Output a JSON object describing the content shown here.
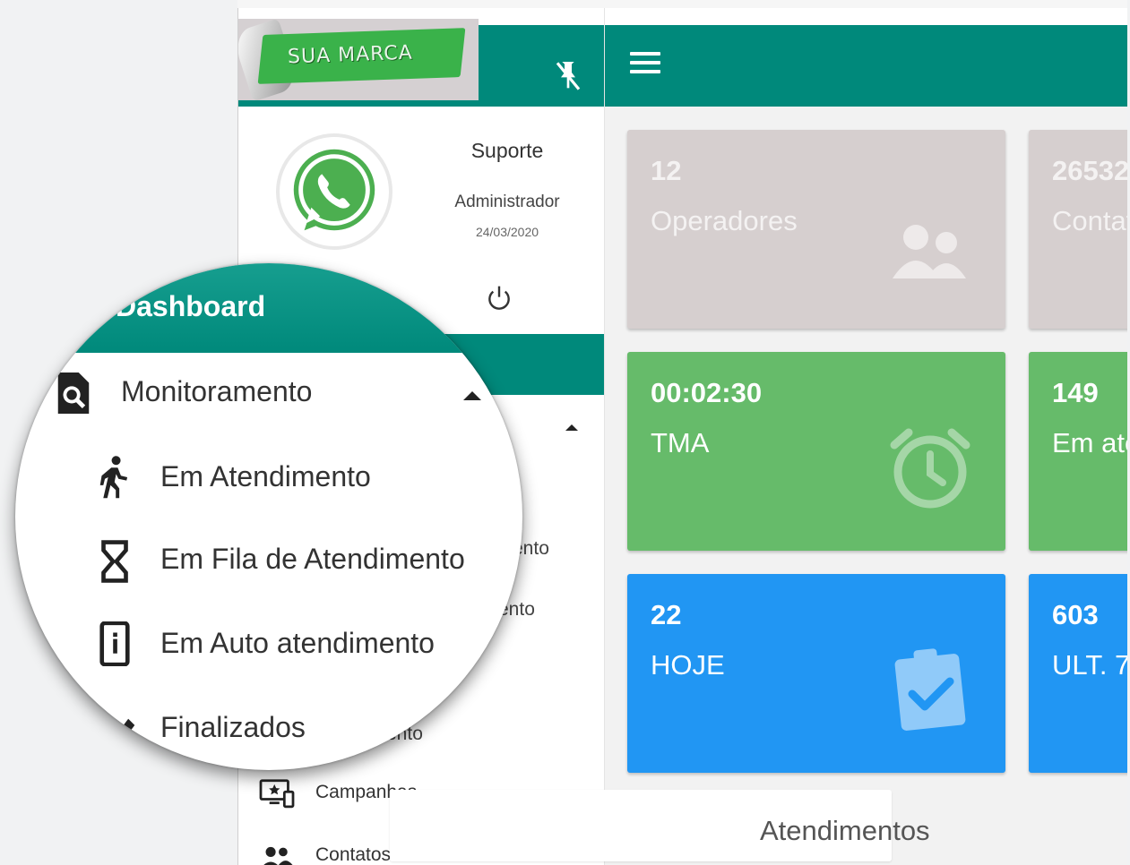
{
  "brand": {
    "logo_text": "SUA MARCA"
  },
  "user": {
    "name": "Suporte",
    "role": "Administrador",
    "date": "24/03/2020"
  },
  "sidebar": {
    "fragments": [
      "ento",
      "ento",
      "ento"
    ],
    "items": [
      {
        "label": "Campanhas",
        "icon": "campaign-monitor-icon",
        "expandable": true
      },
      {
        "label": "Contatos",
        "icon": "contacts-icon",
        "expandable": false
      }
    ]
  },
  "zoom": {
    "dashboard_label": "Dashboard",
    "section_label": "Monitoramento",
    "items": [
      {
        "label": "Em Atendimento",
        "icon": "running-person-icon"
      },
      {
        "label": "Em Fila de Atendimento",
        "icon": "hourglass-icon"
      },
      {
        "label": "Em Auto atendimento",
        "icon": "phone-info-icon"
      },
      {
        "label": "Finalizados",
        "icon": "pen-icon"
      }
    ]
  },
  "cards": [
    {
      "value": "12",
      "label": "Operadores",
      "color": "#d6cfcf",
      "icon": "people-icon"
    },
    {
      "value": "26532",
      "label": "Contatos",
      "color": "#d6cfcf",
      "icon": ""
    },
    {
      "value": "00:02:30",
      "label": "TMA",
      "color": "#66bb6a",
      "icon": "alarm-clock-icon"
    },
    {
      "value": "149",
      "label": "Em atendimento",
      "color": "#66bb6a",
      "icon": ""
    },
    {
      "value": "22",
      "label": "HOJE",
      "color": "#2196f3",
      "icon": "clipboard-check-icon"
    },
    {
      "value": "603",
      "label": "ULT. 7",
      "color": "#2196f3",
      "icon": ""
    }
  ],
  "bottom_panel": {
    "title": "Atendimentos"
  },
  "colors": {
    "primary": "#00897b",
    "grey_card": "#d6cfcf",
    "green_card": "#66bb6a",
    "blue_card": "#2196f3"
  }
}
